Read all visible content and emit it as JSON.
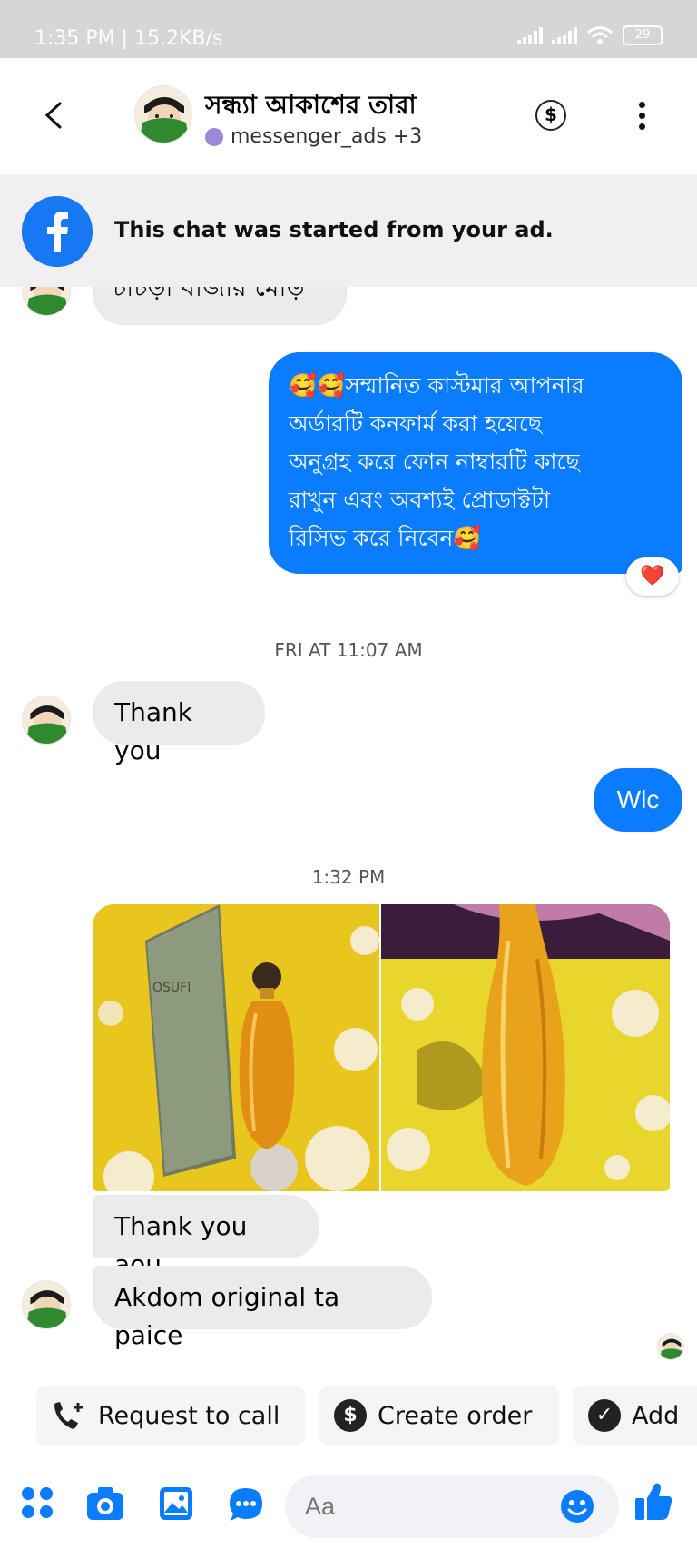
{
  "status_bar": {
    "time": "1:35 PM | 15.2KB/s",
    "battery": "29"
  },
  "header": {
    "contact_name": "সন্ধ্যা আকাশের তারা",
    "subtitle": "messenger_ads +3",
    "dollar_symbol": "$",
    "accent_color": "#1877f2"
  },
  "ad_banner": {
    "text": "This chat was started from your ad."
  },
  "messages": [
    {
      "sender": "contact",
      "text": "চাচড়া বাজার মোড়"
    },
    {
      "sender": "me",
      "lines": [
        "🥰🥰সম্মানিত কাস্টমার আপনার",
        "অর্ডারটি  কনফার্ম করা হয়েছে",
        "অনুগ্রহ করে ফোন নাম্বারটি কাছে",
        "রাখুন এবং অবশ্যই প্রোডাক্টটা",
        "রিসিভ করে নিবেন🥰"
      ],
      "reaction": "❤️"
    },
    {
      "timestamp": "FRI AT 11:07 AM"
    },
    {
      "sender": "contact",
      "text": "Thank you"
    },
    {
      "sender": "me",
      "text": "Wlc"
    },
    {
      "timestamp": "1:32 PM"
    },
    {
      "sender": "contact",
      "type": "photos",
      "photo_brand_text": "OSUFI"
    },
    {
      "sender": "contact",
      "text": "Thank you aou"
    },
    {
      "sender": "contact",
      "text": "Akdom original ta paice"
    }
  ],
  "quick_actions": [
    {
      "label": "Request to call",
      "icon": "phone-plus-icon"
    },
    {
      "label": "Create order",
      "icon": "dollar-icon",
      "icon_glyph": "$"
    },
    {
      "label": "Add",
      "icon": "check-circle-icon",
      "icon_glyph": "✓"
    }
  ],
  "composer": {
    "placeholder": "Aa"
  }
}
